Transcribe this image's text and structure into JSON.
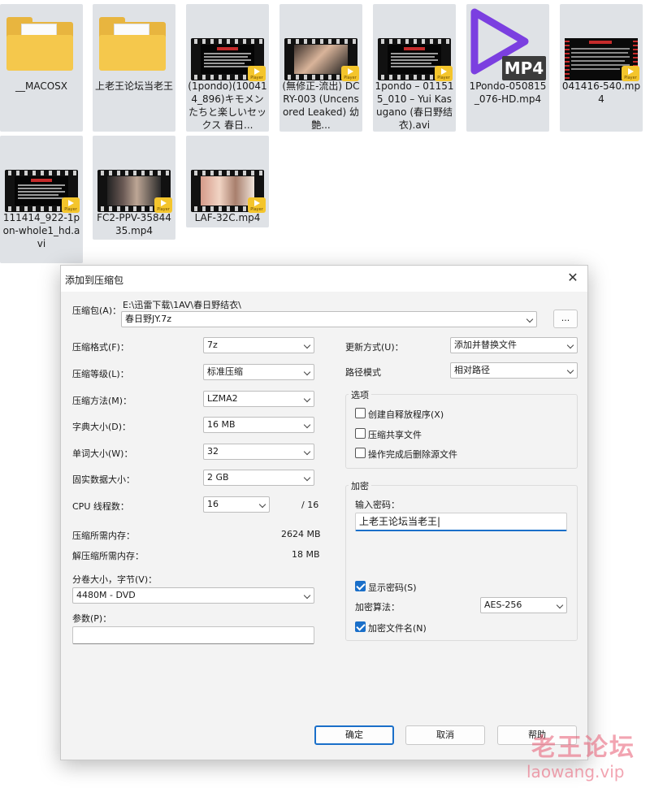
{
  "files": [
    {
      "name": "__MACOSX",
      "kind": "folder"
    },
    {
      "name": "上老王论坛当老王",
      "kind": "folder"
    },
    {
      "name": "(1pondo)(100414_896)キモメンたちと楽しいセックス 春日...",
      "kind": "video-text"
    },
    {
      "name": "(無修正-流出) DCRY-003 (Uncensored Leaked) 幼艶...",
      "kind": "video-photo"
    },
    {
      "name": "1pondo – 011515_010 – Yui Kasugano (春日野结衣).avi",
      "kind": "video-text"
    },
    {
      "name": "1Pondo-050815_076-HD.mp4",
      "kind": "mp4"
    },
    {
      "name": "041416-540.mp4",
      "kind": "video-red"
    },
    {
      "name": "111414_922-1pon-whole1_hd.avi",
      "kind": "video-text"
    },
    {
      "name": "FC2-PPV-3584435.mp4",
      "kind": "video-photo"
    },
    {
      "name": "LAF-32C.mp4",
      "kind": "video-photo"
    }
  ],
  "icons": {
    "folder": "folder-icon",
    "video": "video-file-icon",
    "player_badge": "Player",
    "mp4_badge": "MP4"
  },
  "dialog": {
    "title": "添加到压缩包",
    "close_glyph": "✕",
    "archive_label": "压缩包(A)：",
    "archive_path": "E:\\迅雷下载\\1AV\\春日野结衣\\",
    "archive_name": "春日野JY.7z",
    "browse_label": "...",
    "format_label": "压缩格式(F)：",
    "format_value": "7z",
    "level_label": "压缩等级(L)：",
    "level_value": "标准压缩",
    "method_label": "压缩方法(M)：",
    "method_value": "LZMA2",
    "dict_label": "字典大小(D)：",
    "dict_value": "16 MB",
    "word_label": "单词大小(W)：",
    "word_value": "32",
    "solid_label": "固实数据大小：",
    "solid_value": "2 GB",
    "cpu_label": "CPU 线程数：",
    "cpu_value": "16",
    "cpu_max": "/ 16",
    "mem_comp_label": "压缩所需内存：",
    "mem_comp_value": "2624 MB",
    "mem_decomp_label": "解压缩所需内存：",
    "mem_decomp_value": "18 MB",
    "split_label": "分卷大小，字节(V)：",
    "split_value": "4480M - DVD",
    "params_label": "参数(P)：",
    "params_value": "",
    "update_label": "更新方式(U)：",
    "update_value": "添加并替换文件",
    "pathmode_label": "路径模式",
    "pathmode_value": "相对路径",
    "options_title": "选项",
    "opt_sfx": "创建自释放程序(X)",
    "opt_sfx_checked": false,
    "opt_shared": "压缩共享文件",
    "opt_shared_checked": false,
    "opt_delete": "操作完成后删除源文件",
    "opt_delete_checked": false,
    "encrypt_title": "加密",
    "password_label": "输入密码：",
    "password_value": "上老王论坛当老王|",
    "show_pwd": "显示密码(S)",
    "show_pwd_checked": true,
    "enc_method_label": "加密算法：",
    "enc_method_value": "AES-256",
    "enc_names": "加密文件名(N)",
    "enc_names_checked": true,
    "ok": "确定",
    "cancel": "取消",
    "help": "帮助"
  },
  "watermark": {
    "line1": "老王论坛",
    "line2": "laowang.vip"
  }
}
